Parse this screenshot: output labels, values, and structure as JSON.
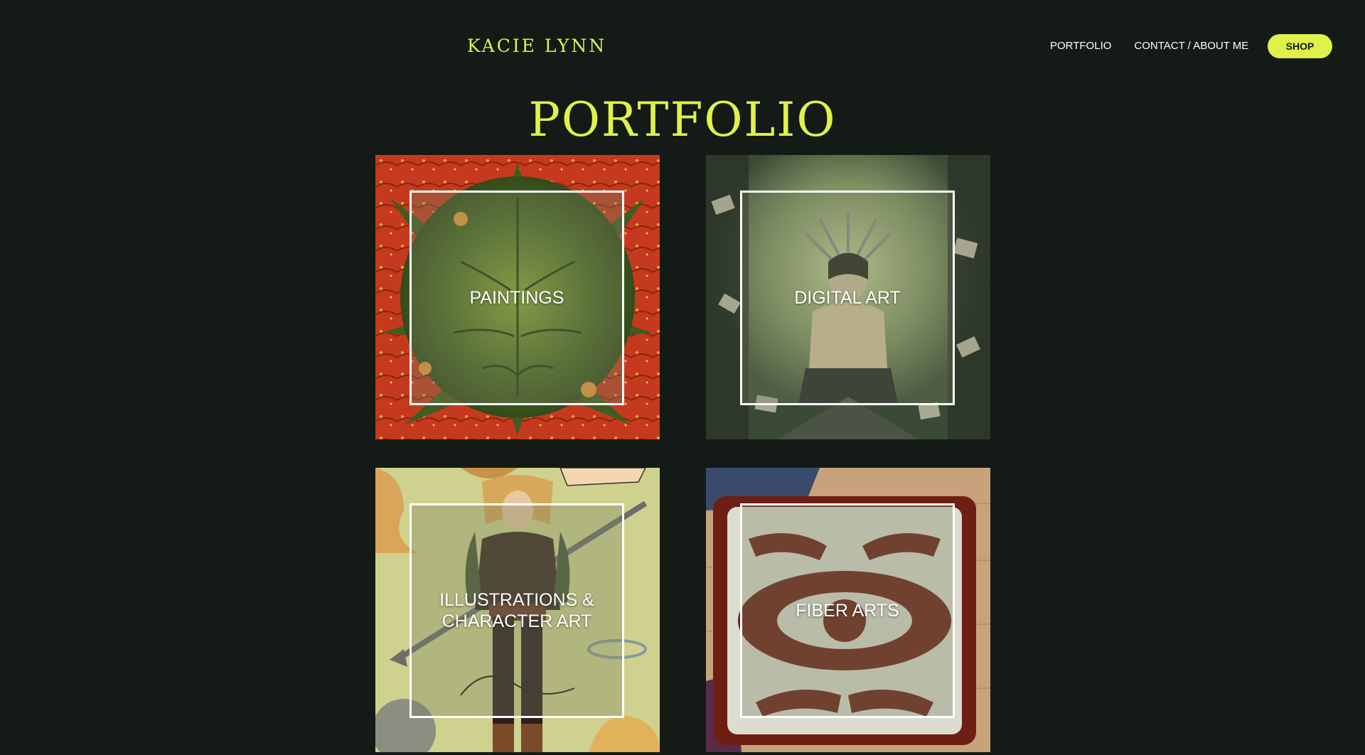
{
  "header": {
    "site_title": "KACIE LYNN",
    "nav": [
      {
        "label": "PORTFOLIO"
      },
      {
        "label": "CONTACT / ABOUT ME"
      }
    ],
    "shop_label": "SHOP"
  },
  "main": {
    "title": "PORTFOLIO",
    "tiles": [
      {
        "label": "PAINTINGS"
      },
      {
        "label": "DIGITAL ART"
      },
      {
        "label": "ILLUSTRATIONS &\nCHARACTER ART"
      },
      {
        "label": "FIBER ARTS"
      }
    ]
  },
  "colors": {
    "background": "#141a15",
    "accent": "#e0f14a",
    "text": "#ffffff"
  }
}
